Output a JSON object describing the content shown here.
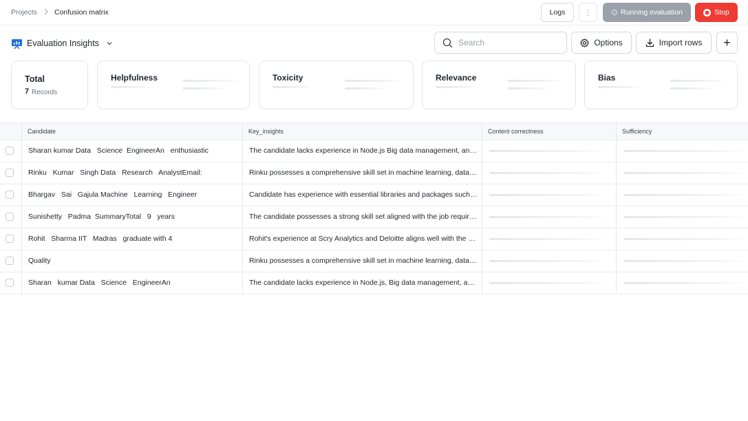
{
  "breadcrumb": {
    "root": "Projects",
    "current": "Confusion matrix"
  },
  "header": {
    "logs_label": "Logs",
    "more_label": "⋮",
    "running_label": "Running evaluation",
    "stop_label": "Stop"
  },
  "toolbar": {
    "title": "Evaluation Insights",
    "search_placeholder": "Search",
    "options_label": "Options",
    "import_label": "Import rows",
    "add_label": "+"
  },
  "summary": {
    "total_title": "Total",
    "total_count": "7",
    "total_unit": "Records",
    "metrics": [
      "Helpfulness",
      "Toxicity",
      "Relevance",
      "Bias"
    ]
  },
  "table": {
    "columns": [
      "Candidate",
      "Key_insights",
      "Content correctness",
      "Sufficiency"
    ],
    "rows": [
      {
        "candidate": "Sharan kumar Data   Science  EngineerAn   enthusiastic",
        "insight": "The candidate lacks experience in Node.js Big data management, and API development, which are key requirements"
      },
      {
        "candidate": "Rinku   Kumar   Singh Data   Research   AnalystEmail:",
        "insight": "Rinku possesses a comprehensive skill set in machine learning, data analysis and research"
      },
      {
        "candidate": "Bhargav   Sai   Gajula Machine   Learning   Engineer",
        "insight": "Candidate has experience with essential libraries and packages such as pandas and numpy"
      },
      {
        "candidate": "Sunishetty   Padma  SummaryTotal   9   years",
        "insight": "The candidate possesses a strong skill set aligned with the job requirements"
      },
      {
        "candidate": "Rohit   Sharma IIT   Madras   graduate with 4",
        "insight": "Rohit's experience at Scry Analytics and Deloitte aligns well with the role"
      },
      {
        "candidate": "Quality",
        "insight": "Rinku possesses a comprehensive skill set in machine learning, data analysis and research"
      },
      {
        "candidate": "Sharan   kumar Data   Science   EngineerAn",
        "insight": "The candidate lacks experience in Node.js, Big data management, and API development"
      }
    ]
  },
  "colors": {
    "accent": "#1d6fe0",
    "stop": "#ee3b33",
    "running": "#9aa1ab"
  }
}
